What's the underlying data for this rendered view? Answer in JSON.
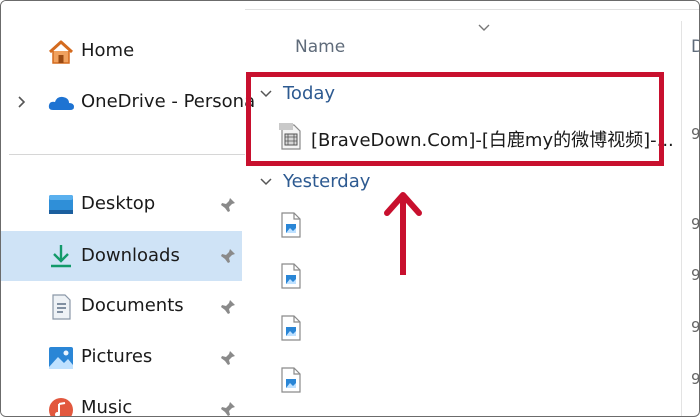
{
  "sidebar": {
    "items": [
      {
        "label": "Home",
        "icon": "home-icon"
      },
      {
        "label": "OneDrive - Persona",
        "icon": "cloud-icon"
      },
      {
        "label": "Desktop",
        "icon": "desktop-icon"
      },
      {
        "label": "Downloads",
        "icon": "download-icon",
        "selected": true
      },
      {
        "label": "Documents",
        "icon": "document-icon"
      },
      {
        "label": "Pictures",
        "icon": "pictures-icon"
      },
      {
        "label": "Music",
        "icon": "music-icon"
      }
    ]
  },
  "file_list": {
    "column_name": "Name",
    "next_column_partial": "D",
    "groups": [
      {
        "label": "Today",
        "files": [
          {
            "name": "[BraveDown.Com]-[白鹿my的微博视频]-..."
          }
        ]
      },
      {
        "label": "Yesterday",
        "files": [
          {
            "name": ""
          },
          {
            "name": ""
          },
          {
            "name": ""
          },
          {
            "name": ""
          }
        ]
      }
    ],
    "edge_digits": [
      "9",
      "9",
      "9",
      "9",
      "9"
    ]
  },
  "colors": {
    "accent_selected": "#cfe3f6",
    "group_header": "#2d5a91",
    "annotation_red": "#c8102e",
    "cloud_blue": "#1e73d2"
  }
}
